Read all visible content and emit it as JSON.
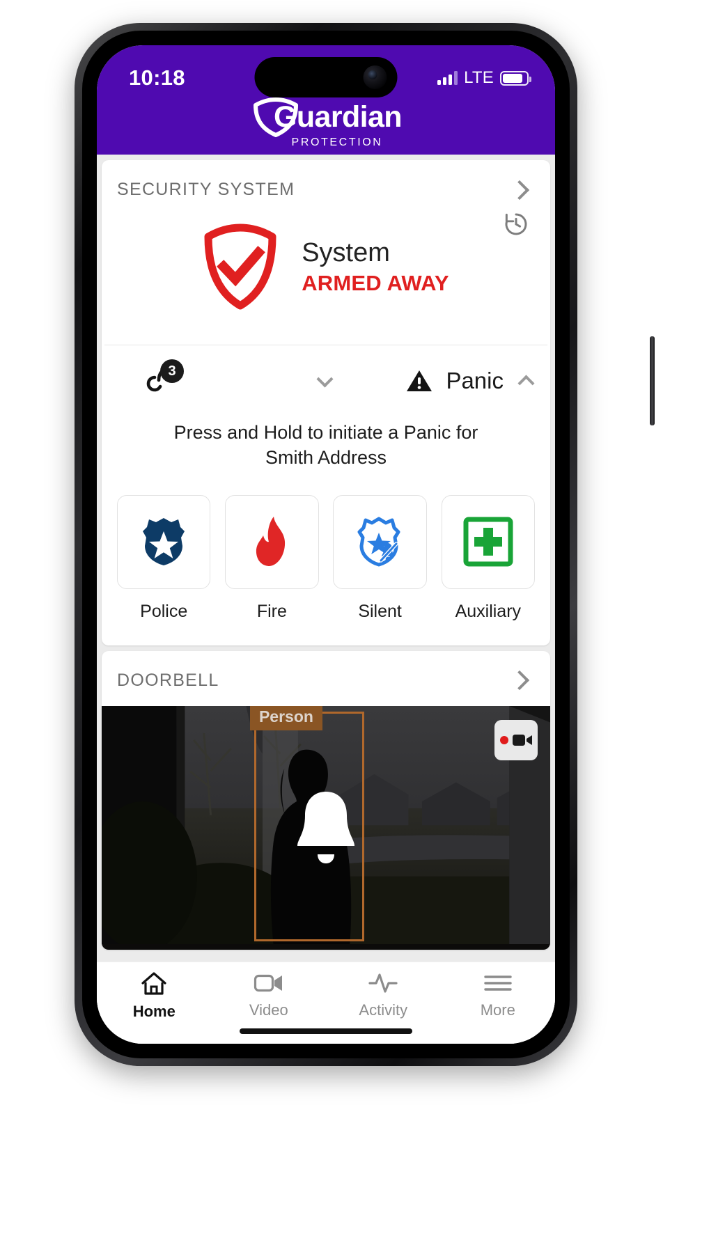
{
  "status_bar": {
    "time": "10:18",
    "network": "LTE",
    "signal_bars": 4,
    "signal_filled": 3,
    "battery_percent": 76
  },
  "brand": {
    "name": "Guardian",
    "subtitle": "PROTECTION",
    "header_color": "#4f0ab0"
  },
  "security_card": {
    "title": "SECURITY SYSTEM",
    "system_label": "System",
    "system_state": "ARMED AWAY",
    "state_color": "#e02020",
    "chevron": "chevron-right-icon",
    "history": "history-icon"
  },
  "panic_tabs": {
    "locks_badge": "3",
    "locks_icon": "lock-open-icon",
    "panic_label": "Panic",
    "panic_icon": "warning-triangle-icon",
    "left_chevron": "chevron-down-icon",
    "right_chevron": "chevron-up-icon"
  },
  "panic": {
    "instruction_line1": "Press and Hold to initiate a Panic for",
    "instruction_line2": "Smith Address",
    "buttons": [
      {
        "label": "Police",
        "icon": "police-badge-icon",
        "color": "#0d3b66"
      },
      {
        "label": "Fire",
        "icon": "flame-icon",
        "color": "#e02626"
      },
      {
        "label": "Silent",
        "icon": "silent-badge-icon",
        "color": "#2a7de1"
      },
      {
        "label": "Auxiliary",
        "icon": "medical-cross-icon",
        "color": "#19a437"
      }
    ]
  },
  "doorbell_card": {
    "title": "DOORBELL",
    "chevron": "chevron-right-icon",
    "detection_label": "Person",
    "record_button": "record-video-icon",
    "bell_overlay": "bell-icon"
  },
  "tabbar": {
    "items": [
      {
        "label": "Home",
        "icon": "home-icon",
        "active": true
      },
      {
        "label": "Video",
        "icon": "video-icon",
        "active": false
      },
      {
        "label": "Activity",
        "icon": "activity-icon",
        "active": false
      },
      {
        "label": "More",
        "icon": "menu-icon",
        "active": false
      }
    ]
  }
}
